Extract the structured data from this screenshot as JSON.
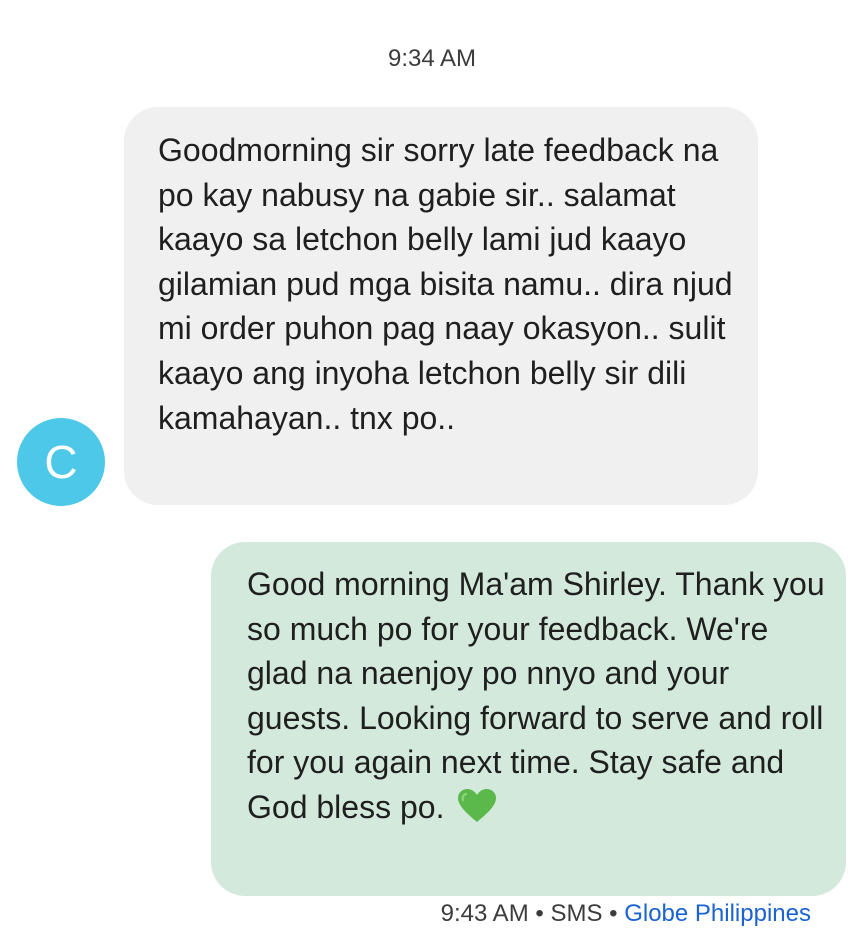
{
  "conversation": {
    "header_time": "9:34 AM",
    "contact": {
      "avatar_initial": "C",
      "avatar_color": "#4dc8e8"
    },
    "incoming_message": {
      "text": "Goodmorning sir sorry late feedback na po kay nabusy na gabie sir.. salamat kaayo sa letchon belly lami jud kaayo gilamian pud mga bisita namu.. dira njud mi order puhon pag naay okasyon.. sulit kaayo ang inyoha letchon belly sir dili kamahayan.. tnx po..",
      "bubble_color": "#f0f0f0"
    },
    "outgoing_message": {
      "text": "Good morning Ma'am Shirley. Thank you so much po for your feedback. We're glad na naenjoy po nnyo and your guests. Looking forward to serve and roll for you again next time. Stay safe and God bless po.",
      "emoji": "green-heart-icon",
      "bubble_color": "#d3e9db",
      "status": {
        "time": "9:43 AM",
        "separator": "•",
        "type": "SMS",
        "carrier": "Globe Philippines",
        "carrier_color": "#1a63d1"
      }
    }
  }
}
